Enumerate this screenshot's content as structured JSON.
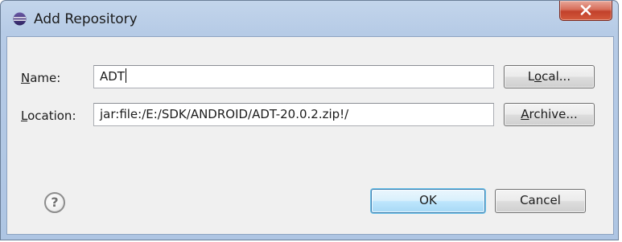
{
  "window": {
    "title": "Add Repository",
    "close_label": "x"
  },
  "form": {
    "name_label": {
      "prefix": "",
      "accel": "N",
      "suffix": "ame:"
    },
    "name_value": "ADT",
    "location_label": {
      "prefix": "",
      "accel": "L",
      "suffix": "ocation:"
    },
    "location_value": "jar:file:/E:/SDK/ANDROID/ADT-20.0.2.zip!/"
  },
  "buttons": {
    "local": {
      "prefix": "L",
      "accel": "o",
      "suffix": "cal..."
    },
    "archive": {
      "prefix": "",
      "accel": "A",
      "suffix": "rchive..."
    },
    "ok": "OK",
    "cancel": "Cancel"
  },
  "help": {
    "glyph": "?"
  },
  "icons": {
    "title": "eclipse-icon",
    "close": "close-icon",
    "help": "help-icon"
  },
  "colors": {
    "title_bar": "#b6cbe6",
    "client_bg": "#f0f0f0",
    "close_button": "#c2412b",
    "default_button": "#bee6fd"
  }
}
